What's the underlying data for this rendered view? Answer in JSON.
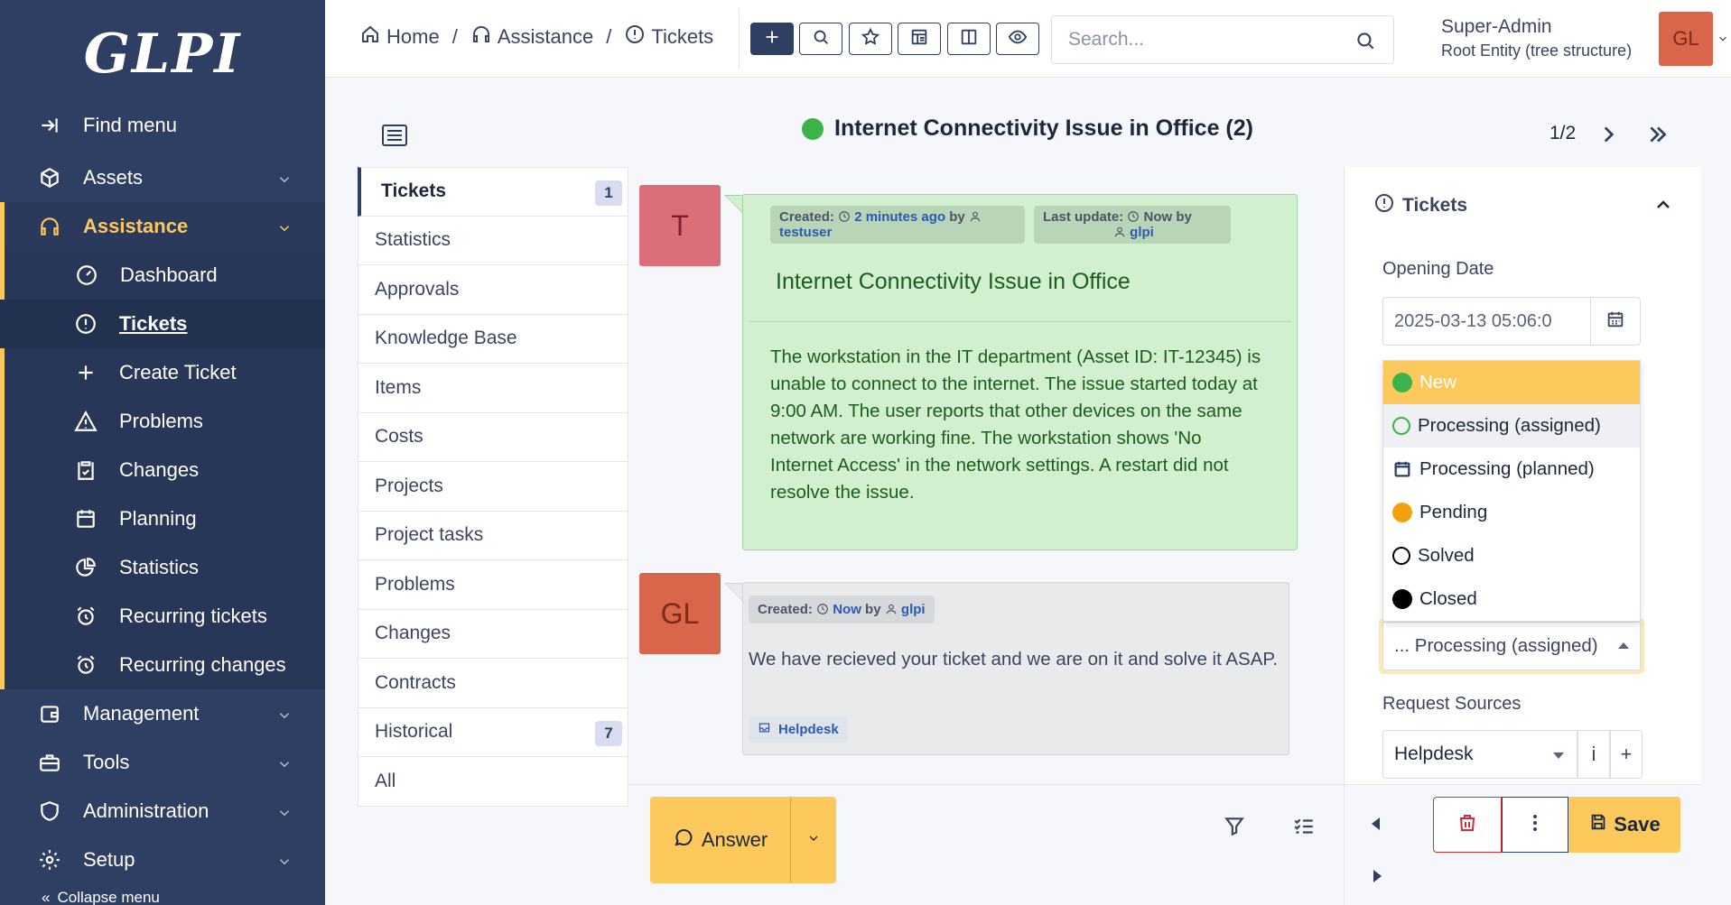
{
  "app": {
    "logo": "GLPI"
  },
  "sidebar": {
    "find_menu": "Find menu",
    "items": [
      {
        "label": "Assets",
        "icon": "box-icon"
      },
      {
        "label": "Assistance",
        "icon": "headset-icon"
      },
      {
        "label": "Management",
        "icon": "wallet-icon"
      },
      {
        "label": "Tools",
        "icon": "briefcase-icon"
      },
      {
        "label": "Administration",
        "icon": "shield-icon"
      },
      {
        "label": "Setup",
        "icon": "gear-icon"
      }
    ],
    "sub_items": [
      {
        "label": "Dashboard",
        "icon": "gauge-icon"
      },
      {
        "label": "Tickets",
        "icon": "alert-circle-icon"
      },
      {
        "label": "Create Ticket",
        "icon": "plus-icon"
      },
      {
        "label": "Problems",
        "icon": "warning-triangle-icon"
      },
      {
        "label": "Changes",
        "icon": "clipboard-check-icon"
      },
      {
        "label": "Planning",
        "icon": "calendar-icon"
      },
      {
        "label": "Statistics",
        "icon": "pie-chart-icon"
      },
      {
        "label": "Recurring tickets",
        "icon": "alarm-icon"
      },
      {
        "label": "Recurring changes",
        "icon": "alarm-icon"
      }
    ],
    "collapse": "Collapse menu",
    "accent_color": "#fec95c",
    "bg_color": "#2f3f64"
  },
  "topbar": {
    "breadcrumb": [
      "Home",
      "Assistance",
      "Tickets"
    ],
    "search_placeholder": "Search...",
    "user_name": "Super-Admin",
    "user_entity": "Root Entity (tree structure)",
    "avatar_initials": "GL"
  },
  "ticket": {
    "title": "Internet Connectivity Issue in Office (2)",
    "status_color": "#3cb34a",
    "pager": "1/2"
  },
  "tabs": [
    {
      "label": "Tickets",
      "badge": "1"
    },
    {
      "label": "Statistics"
    },
    {
      "label": "Approvals"
    },
    {
      "label": "Knowledge Base"
    },
    {
      "label": "Items"
    },
    {
      "label": "Costs"
    },
    {
      "label": "Projects"
    },
    {
      "label": "Project tasks"
    },
    {
      "label": "Problems"
    },
    {
      "label": "Changes"
    },
    {
      "label": "Contracts"
    },
    {
      "label": "Historical",
      "badge": "7"
    },
    {
      "label": "All"
    }
  ],
  "timeline": {
    "item1": {
      "avatar": "T",
      "created_label": "Created:",
      "created_time": "2 minutes ago",
      "by": "by",
      "created_user": "testuser",
      "updated_label": "Last update:",
      "updated_time": "Now",
      "updated_user": "glpi",
      "title": "Internet Connectivity Issue in Office",
      "body": "The workstation in the IT department (Asset ID: IT-12345) is unable to connect to the internet. The issue started today at 9:00 AM. The user reports that other devices on the same network are working fine. The workstation shows 'No Internet Access' in the network settings. A restart did not resolve the issue."
    },
    "item2": {
      "avatar": "GL",
      "created_label": "Created:",
      "created_time": "Now",
      "by": "by",
      "created_user": "glpi",
      "body": "We have recieved your ticket and we are on it and solve it ASAP.",
      "source": "Helpdesk"
    }
  },
  "actions": {
    "answer": "Answer",
    "save": "Save"
  },
  "right_panel": {
    "header": "Tickets",
    "opening_date_label": "Opening Date",
    "opening_date_value": "2025-03-13 05:06:0",
    "status_options": [
      {
        "label": "New",
        "color": "#3cb34a",
        "style": "filled"
      },
      {
        "label": "Processing (assigned)",
        "color": "#3cb34a",
        "style": "ring"
      },
      {
        "label": "Processing (planned)",
        "color": "#2f3f64",
        "style": "calendar"
      },
      {
        "label": "Pending",
        "color": "#f5a10f",
        "style": "filled"
      },
      {
        "label": "Solved",
        "color": "#000000",
        "style": "ring"
      },
      {
        "label": "Closed",
        "color": "#000000",
        "style": "filled"
      }
    ],
    "status_selected": "... Processing (assigned)",
    "request_sources_label": "Request Sources",
    "request_source_value": "Helpdesk",
    "info_btn": "i",
    "add_btn": "+"
  }
}
